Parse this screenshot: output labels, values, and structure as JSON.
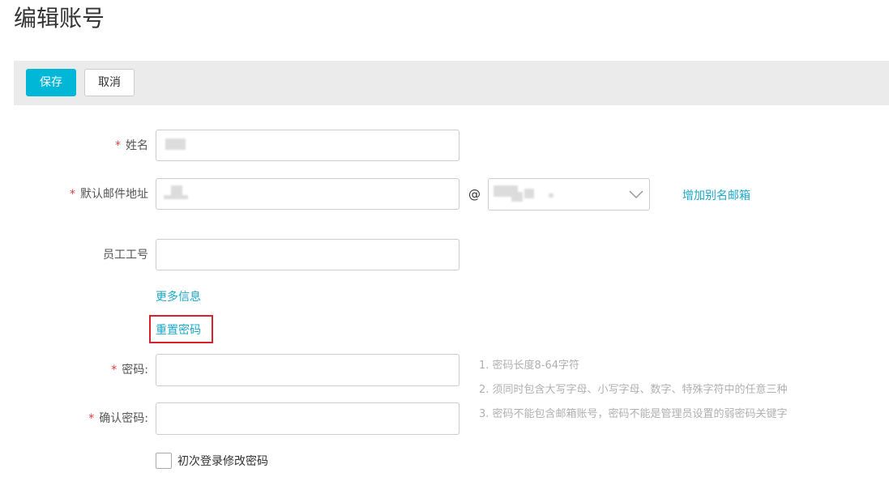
{
  "page": {
    "title": "编辑账号"
  },
  "toolbar": {
    "save_label": "保存",
    "cancel_label": "取消"
  },
  "form": {
    "name": {
      "required_mark": "*",
      "label": "姓名"
    },
    "email": {
      "required_mark": "*",
      "label": "默认邮件地址",
      "at_sign": "@",
      "add_alias_link": "增加别名邮箱"
    },
    "employee_id": {
      "label": "员工工号",
      "value": ""
    },
    "more_info_link": "更多信息",
    "reset_password_link": "重置密码",
    "password": {
      "required_mark": "*",
      "label": "密码:",
      "value": ""
    },
    "confirm_password": {
      "required_mark": "*",
      "label": "确认密码:",
      "value": ""
    },
    "password_hints": [
      "1. 密码长度8-64字符",
      "2. 须同时包含大写字母、小写字母、数字、特殊字符中的任意三种",
      "3. 密码不能包含邮箱账号，密码不能是管理员设置的弱密码关键字"
    ],
    "first_login_change": {
      "label": "初次登录修改密码",
      "checked": false
    }
  },
  "colors": {
    "accent": "#00b7d8",
    "link": "#1ba8c8",
    "required": "#e4393c",
    "highlight_border": "#d9222a"
  }
}
